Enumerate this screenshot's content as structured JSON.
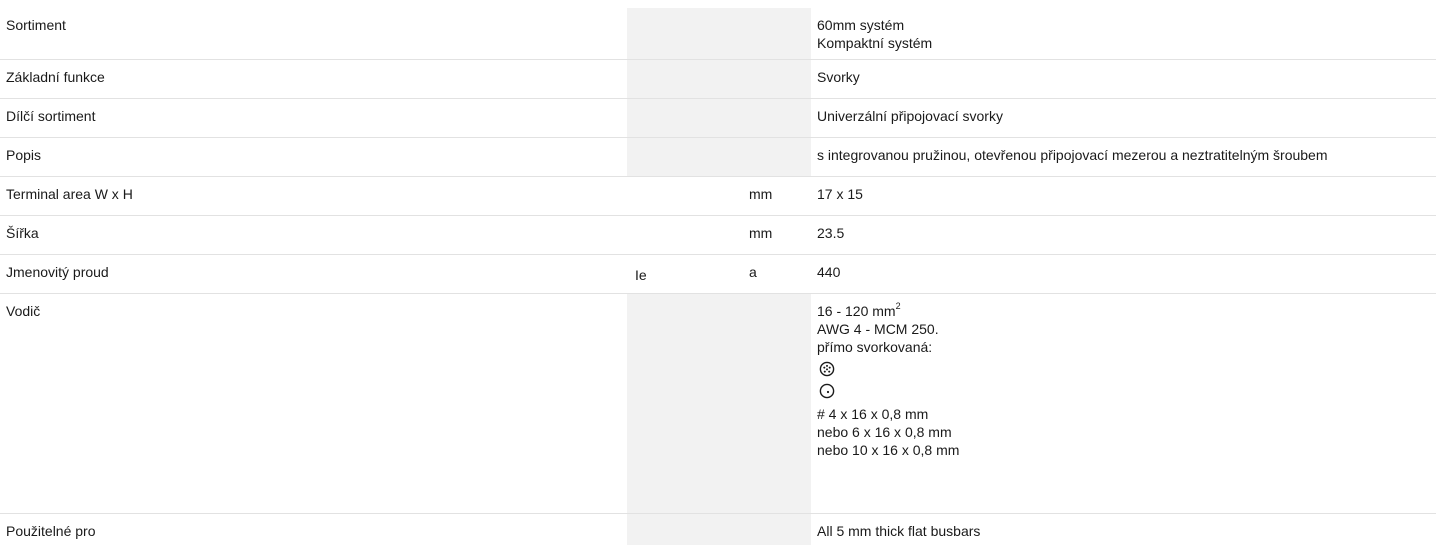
{
  "header": {
    "title_fragment": ""
  },
  "rows": [
    {
      "label": "Sortiment",
      "symbol": "",
      "unit": "",
      "values": [
        "60mm systém",
        "Kompaktní systém"
      ]
    },
    {
      "label": "Základní funkce",
      "symbol": "",
      "unit": "",
      "values": [
        "Svorky"
      ]
    },
    {
      "label": "Dílčí sortiment",
      "symbol": "",
      "unit": "",
      "values": [
        "Univerzální připojovací svorky"
      ]
    },
    {
      "label": "Popis",
      "symbol": "",
      "unit": "",
      "values": [
        "s integrovanou pružinou, otevřenou připojovací mezerou a neztratitelným šroubem"
      ]
    },
    {
      "label": "Terminal area W x H",
      "symbol": "",
      "unit": "mm",
      "values": [
        "17 x 15"
      ]
    },
    {
      "label": "Šířka",
      "symbol": "",
      "unit": "mm",
      "values": [
        "23.5"
      ]
    },
    {
      "label": "Jmenovitý proud",
      "symbol": "Ie",
      "unit": "a",
      "values": [
        "440"
      ]
    },
    {
      "label": "Vodič",
      "symbol": "",
      "unit": "",
      "conductor": {
        "cross_section_main": "16 - 120 mm",
        "cross_section_sup": "2",
        "awg": "AWG 4 - MCM 250.",
        "clamped_label": "přímo svorkovaná:",
        "icon_stranded": "stranded-conductor-icon",
        "icon_solid": "solid-conductor-icon",
        "busbar_1": "# 4 x 16 x 0,8 mm",
        "busbar_2": "nebo 6 x 16 x 0,8 mm",
        "busbar_3": "nebo 10 x 16 x 0,8 mm"
      }
    },
    {
      "label": "Použitelné pro",
      "symbol": "",
      "unit": "",
      "values": [
        "All 5 mm thick flat busbars"
      ]
    }
  ],
  "colors": {
    "heading_blue": "#2a6fb3",
    "shaded_cell": "#f2f2f2",
    "row_divider": "#e2e2e2",
    "text": "#1a1a1a"
  }
}
